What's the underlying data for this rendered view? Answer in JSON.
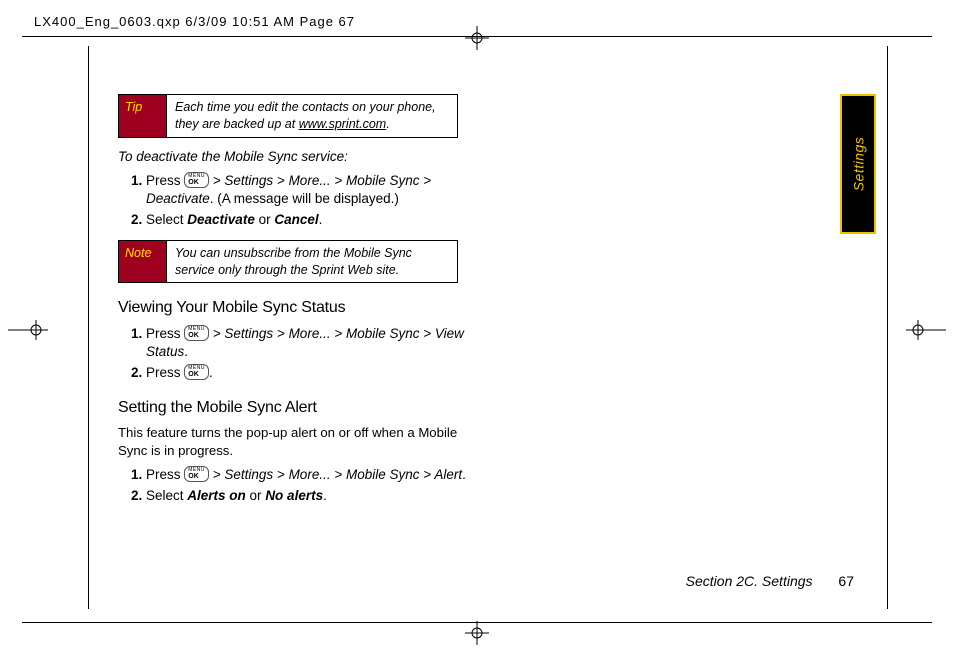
{
  "header": {
    "line": "LX400_Eng_0603.qxp  6/3/09  10:51 AM  Page 67"
  },
  "sideTab": {
    "label": "Settings"
  },
  "tip": {
    "label": "Tip",
    "body_pre": "Each time you edit the contacts on your phone, they are backed up at ",
    "link": "www.sprint.com",
    "body_post": "."
  },
  "deactivate": {
    "lead": "To deactivate the Mobile Sync service:",
    "step1_pre": "Press ",
    "step1_path": "> Settings > More... > Mobile Sync > Deactivate",
    "step1_post": ". (A message will be displayed.)",
    "step2_pre": "Select ",
    "step2_opt1": "Deactivate",
    "step2_or": " or ",
    "step2_opt2": "Cancel",
    "step2_post": "."
  },
  "note": {
    "label": "Note",
    "body": "You can unsubscribe from the Mobile Sync service only through the Sprint Web site."
  },
  "viewing": {
    "heading": "Viewing Your Mobile Sync Status",
    "step1_pre": "Press ",
    "step1_path": "> Settings > More... > Mobile Sync > View Status",
    "step1_post": ".",
    "step2_pre": "Press ",
    "step2_post": "."
  },
  "setting": {
    "heading": "Setting the Mobile Sync Alert",
    "body": "This feature turns the pop-up alert on or off when a Mobile Sync is in progress.",
    "step1_pre": "Press ",
    "step1_path": "> Settings > More... > Mobile Sync > Alert",
    "step1_post": ".",
    "step2_pre": "Select ",
    "step2_opt1": "Alerts on",
    "step2_or": " or ",
    "step2_opt2": "No alerts",
    "step2_post": "."
  },
  "footer": {
    "section": "Section 2C. Settings",
    "page": "67"
  },
  "okbtn": {
    "top": "MENU",
    "bot": "OK"
  }
}
